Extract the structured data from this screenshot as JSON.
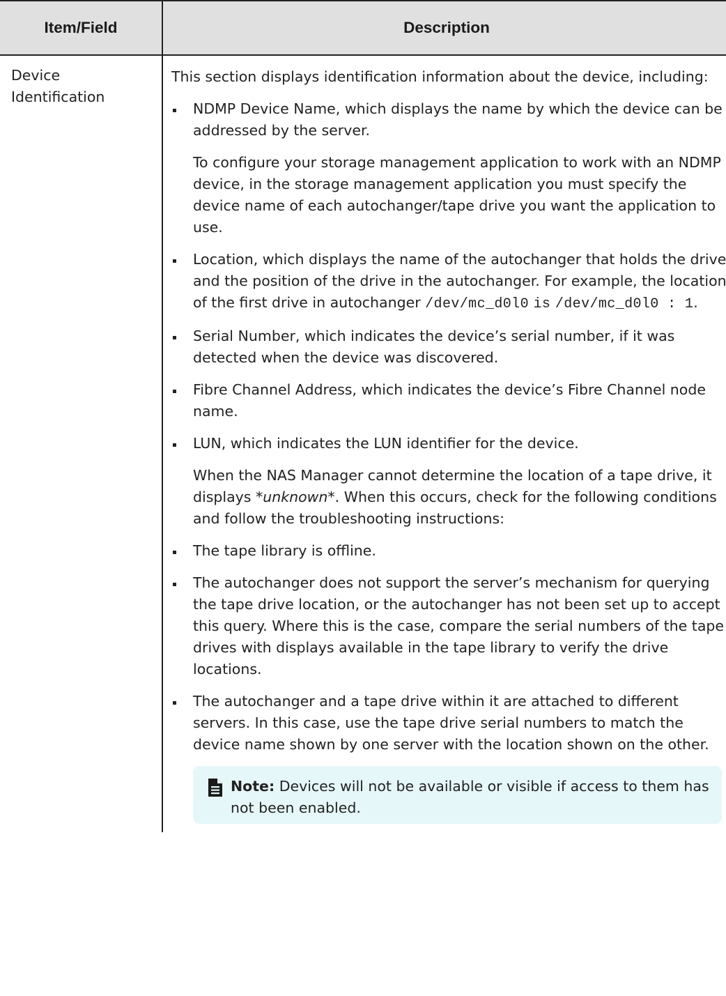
{
  "header": {
    "col1": "Item/Field",
    "col2": "Description"
  },
  "row": {
    "item": "Device Identification",
    "intro": "This section displays identification information about the device, including:",
    "bullet1": "NDMP Device Name, which displays the name by which the device can be addressed by the server.",
    "bullet1_sub": "To configure your storage management application to work with an NDMP device, in the storage management application you must specify the device name of each autochanger/tape drive you want the application to use.",
    "bullet2_text": "Location, which displays the name of the autochanger that holds the drive and the position of the drive in the autochanger. For example, the location of the first drive in autochanger",
    "bullet2_code1": "/dev/mc_d0l0",
    "bullet2_is": "is",
    "bullet2_code2": "/dev/mc_d0l0 : 1",
    "bullet2_end": ".",
    "bullet3": "Serial Number, which indicates the device’s serial number, if it was detected when the device was discovered.",
    "bullet4": "Fibre Channel Address, which indicates the device’s Fibre Channel node name.",
    "bullet5": "LUN, which indicates the LUN identifier for the device.",
    "unknown_pre": "When the NAS Manager cannot determine the location of a tape drive, it displays",
    "unknown_em": "*unknown*",
    "unknown_post": ". When this occurs, check for the following conditions and follow the troubleshooting instructions:",
    "cond1": "The tape library is offline.",
    "cond2": "The autochanger does not support the server’s mechanism for querying the tape drive location, or the autochanger has not been set up to accept this query. Where this is the case, compare the serial numbers of the tape drives with displays available in the tape library to verify the drive locations.",
    "cond3": "The autochanger and a tape drive within it are attached to different servers. In this case, use the tape drive serial numbers to match the device name shown by one server with the location shown on the other.",
    "note_label": "Note:",
    "note_text": "Devices will not be available or visible if access to them has not been enabled."
  }
}
